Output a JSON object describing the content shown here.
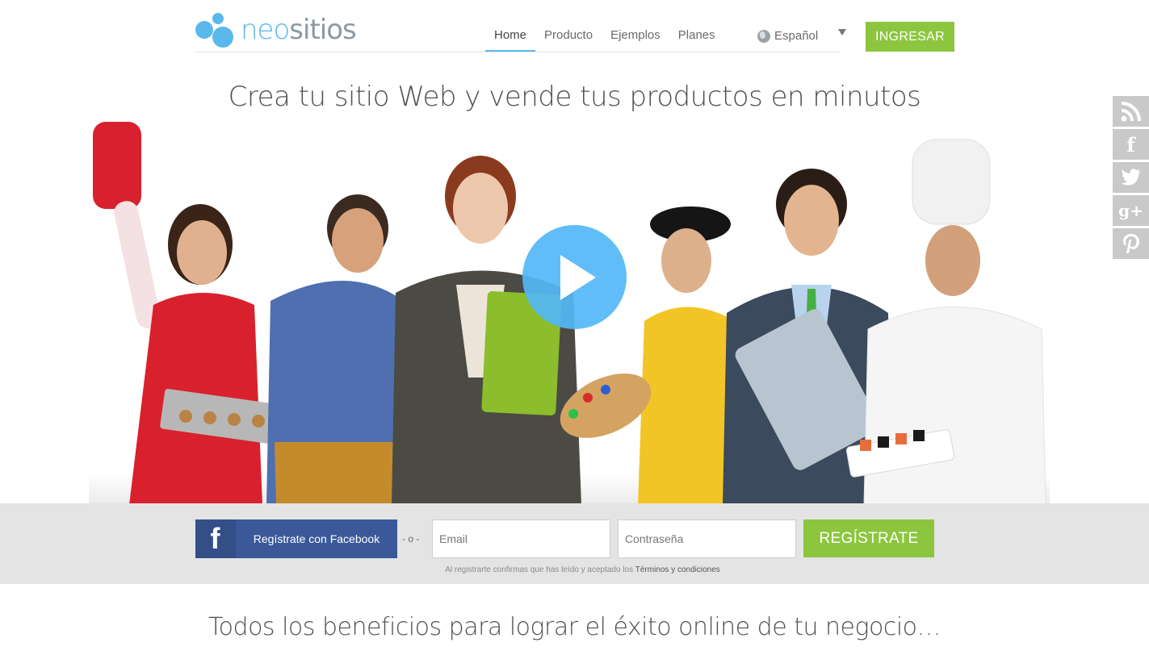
{
  "brand": {
    "logo_neo": "neo",
    "logo_sitios": "sitios"
  },
  "nav": {
    "items": [
      {
        "label": "Home",
        "active": true
      },
      {
        "label": "Producto",
        "active": false
      },
      {
        "label": "Ejemplos",
        "active": false
      },
      {
        "label": "Planes",
        "active": false
      }
    ],
    "language": "Español",
    "login_label": "INGRESAR"
  },
  "hero": {
    "title": "Crea tu sitio Web y vende tus productos en minutos",
    "play_icon": "play-icon"
  },
  "social": [
    "rss-icon",
    "facebook-icon",
    "twitter-icon",
    "google-plus-icon",
    "pinterest-icon"
  ],
  "signup": {
    "facebook_label": "Regístrate con Facebook",
    "separator": "- o -",
    "email_placeholder": "Email",
    "password_placeholder": "Contraseña",
    "register_label": "REGÍSTRATE",
    "terms_text": "Al registrarte confirmas que has leído y aceptado los",
    "terms_link": "Términos y condiciones"
  },
  "benefits": {
    "title": "Todos los beneficios para lograr el éxito online de tu negocio…"
  },
  "colors": {
    "accent_blue": "#5bb8ec",
    "accent_green": "#8cc63e",
    "facebook_blue": "#3b5998",
    "social_gray": "#c9c9c9"
  }
}
